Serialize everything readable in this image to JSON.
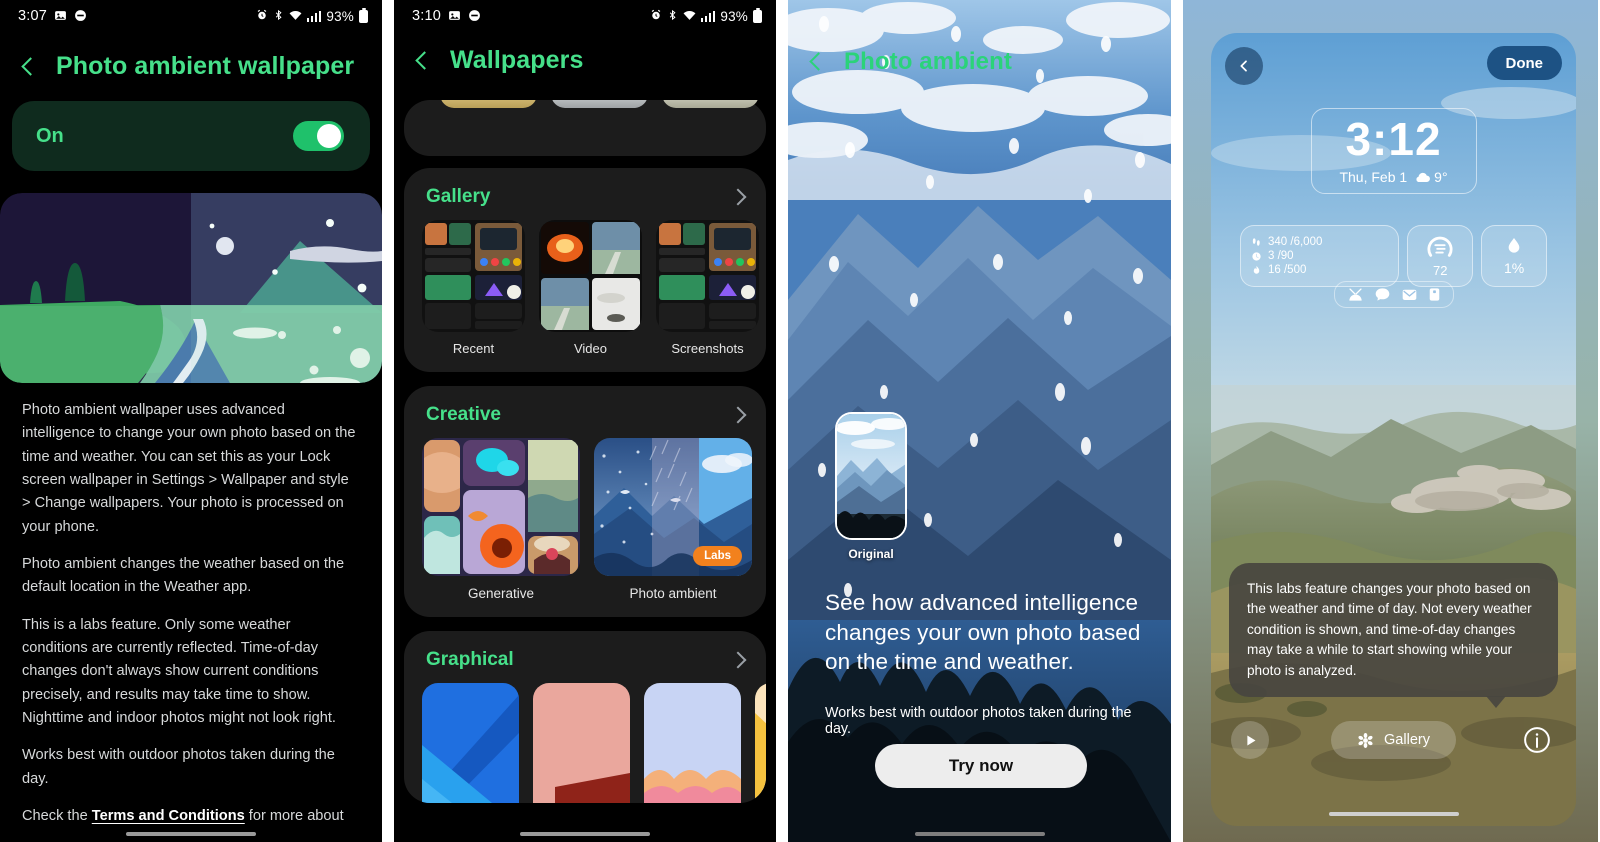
{
  "panel1": {
    "status": {
      "time": "3:07",
      "battery": "93%",
      "icons": [
        "image-icon",
        "dnd-icon",
        "alarm-icon",
        "bluetooth-icon",
        "wifi-icon",
        "signal-icon",
        "battery-icon"
      ]
    },
    "title": "Photo ambient wallpaper",
    "toggle": {
      "label": "On",
      "state": "on"
    },
    "paragraphs": [
      "Photo ambient wallpaper uses advanced intelligence to change your own photo based on the time and weather. You can set this as your Lock screen wallpaper in Settings > Wallpaper and style > Change wallpapers. Your photo is processed on your phone.",
      "Photo ambient changes the weather based on the default location in the Weather app.",
      "This is a labs feature. Only some weather conditions are currently reflected. Time-of-day changes don't always show current conditions precisely, and results may take time to show. Nighttime and indoor photos might not look right.",
      "Works best with outdoor photos taken during the day."
    ],
    "last_line_prefix": "Check the ",
    "terms_link": "Terms and Conditions",
    "last_line_suffix": " for more about"
  },
  "panel2": {
    "status": {
      "time": "3:10",
      "battery": "93%"
    },
    "title": "Wallpapers",
    "sections": [
      {
        "title": "Gallery",
        "items": [
          {
            "label": "Recent"
          },
          {
            "label": "Video"
          },
          {
            "label": "Screenshots"
          }
        ]
      },
      {
        "title": "Creative",
        "items": [
          {
            "label": "Generative",
            "badge": ""
          },
          {
            "label": "Photo ambient",
            "badge": "Labs"
          }
        ]
      },
      {
        "title": "Graphical",
        "items": []
      }
    ]
  },
  "panel3": {
    "title": "Photo ambient",
    "original_label": "Original",
    "headline": "See how advanced intelligence changes your own photo based on the time and weather.",
    "subtext": "Works best with outdoor photos taken during the day.",
    "cta": "Try now"
  },
  "panel4": {
    "done_label": "Done",
    "clock": {
      "time": "3:12",
      "date": "Thu, Feb 1",
      "temp": "9°"
    },
    "widgets": {
      "fitness": [
        {
          "icon": "steps-icon",
          "value": "340 /6,000"
        },
        {
          "icon": "time-icon",
          "value": "3 /90"
        },
        {
          "icon": "calories-icon",
          "value": "16 /500"
        }
      ],
      "gauge": {
        "icon": "air-quality-icon",
        "value": "72"
      },
      "humidity": {
        "icon": "droplet-icon",
        "value": "1%"
      }
    },
    "shortcut_icons": [
      "contacts-icon",
      "chat-icon",
      "mail-icon",
      "phone-icon"
    ],
    "tooltip": "This labs feature changes your photo based on the weather and time of day. Not every weather condition is shown, and time-of-day changes may take a while to start showing while your photo is analyzed.",
    "bottom": {
      "play_label": "play-icon",
      "gallery_label": "Gallery",
      "gallery_icon": "asterisk-icon",
      "info_label": "info-icon"
    }
  },
  "colors": {
    "accent_green": "#46e08a",
    "toggle_green": "#1fc16b",
    "labs_orange": "#f2811d",
    "dark_card": "#1c1c1c",
    "done_blue": "#1d5284"
  }
}
